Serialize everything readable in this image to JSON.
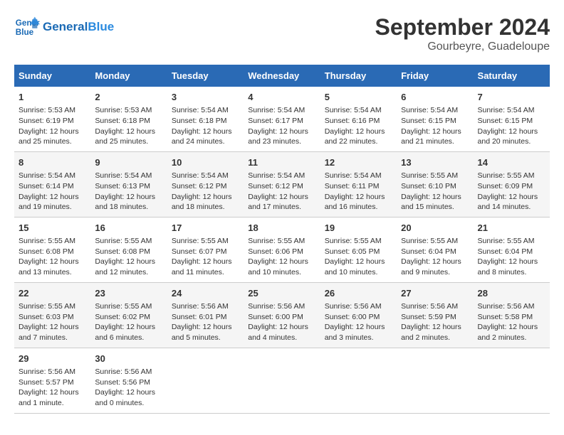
{
  "header": {
    "logo_line1": "General",
    "logo_line2": "Blue",
    "month": "September 2024",
    "location": "Gourbeyre, Guadeloupe"
  },
  "days_of_week": [
    "Sunday",
    "Monday",
    "Tuesday",
    "Wednesday",
    "Thursday",
    "Friday",
    "Saturday"
  ],
  "weeks": [
    [
      {
        "day": "1",
        "info": "Sunrise: 5:53 AM\nSunset: 6:19 PM\nDaylight: 12 hours and 25 minutes."
      },
      {
        "day": "2",
        "info": "Sunrise: 5:53 AM\nSunset: 6:18 PM\nDaylight: 12 hours and 25 minutes."
      },
      {
        "day": "3",
        "info": "Sunrise: 5:54 AM\nSunset: 6:18 PM\nDaylight: 12 hours and 24 minutes."
      },
      {
        "day": "4",
        "info": "Sunrise: 5:54 AM\nSunset: 6:17 PM\nDaylight: 12 hours and 23 minutes."
      },
      {
        "day": "5",
        "info": "Sunrise: 5:54 AM\nSunset: 6:16 PM\nDaylight: 12 hours and 22 minutes."
      },
      {
        "day": "6",
        "info": "Sunrise: 5:54 AM\nSunset: 6:15 PM\nDaylight: 12 hours and 21 minutes."
      },
      {
        "day": "7",
        "info": "Sunrise: 5:54 AM\nSunset: 6:15 PM\nDaylight: 12 hours and 20 minutes."
      }
    ],
    [
      {
        "day": "8",
        "info": "Sunrise: 5:54 AM\nSunset: 6:14 PM\nDaylight: 12 hours and 19 minutes."
      },
      {
        "day": "9",
        "info": "Sunrise: 5:54 AM\nSunset: 6:13 PM\nDaylight: 12 hours and 18 minutes."
      },
      {
        "day": "10",
        "info": "Sunrise: 5:54 AM\nSunset: 6:12 PM\nDaylight: 12 hours and 18 minutes."
      },
      {
        "day": "11",
        "info": "Sunrise: 5:54 AM\nSunset: 6:12 PM\nDaylight: 12 hours and 17 minutes."
      },
      {
        "day": "12",
        "info": "Sunrise: 5:54 AM\nSunset: 6:11 PM\nDaylight: 12 hours and 16 minutes."
      },
      {
        "day": "13",
        "info": "Sunrise: 5:55 AM\nSunset: 6:10 PM\nDaylight: 12 hours and 15 minutes."
      },
      {
        "day": "14",
        "info": "Sunrise: 5:55 AM\nSunset: 6:09 PM\nDaylight: 12 hours and 14 minutes."
      }
    ],
    [
      {
        "day": "15",
        "info": "Sunrise: 5:55 AM\nSunset: 6:08 PM\nDaylight: 12 hours and 13 minutes."
      },
      {
        "day": "16",
        "info": "Sunrise: 5:55 AM\nSunset: 6:08 PM\nDaylight: 12 hours and 12 minutes."
      },
      {
        "day": "17",
        "info": "Sunrise: 5:55 AM\nSunset: 6:07 PM\nDaylight: 12 hours and 11 minutes."
      },
      {
        "day": "18",
        "info": "Sunrise: 5:55 AM\nSunset: 6:06 PM\nDaylight: 12 hours and 10 minutes."
      },
      {
        "day": "19",
        "info": "Sunrise: 5:55 AM\nSunset: 6:05 PM\nDaylight: 12 hours and 10 minutes."
      },
      {
        "day": "20",
        "info": "Sunrise: 5:55 AM\nSunset: 6:04 PM\nDaylight: 12 hours and 9 minutes."
      },
      {
        "day": "21",
        "info": "Sunrise: 5:55 AM\nSunset: 6:04 PM\nDaylight: 12 hours and 8 minutes."
      }
    ],
    [
      {
        "day": "22",
        "info": "Sunrise: 5:55 AM\nSunset: 6:03 PM\nDaylight: 12 hours and 7 minutes."
      },
      {
        "day": "23",
        "info": "Sunrise: 5:55 AM\nSunset: 6:02 PM\nDaylight: 12 hours and 6 minutes."
      },
      {
        "day": "24",
        "info": "Sunrise: 5:56 AM\nSunset: 6:01 PM\nDaylight: 12 hours and 5 minutes."
      },
      {
        "day": "25",
        "info": "Sunrise: 5:56 AM\nSunset: 6:00 PM\nDaylight: 12 hours and 4 minutes."
      },
      {
        "day": "26",
        "info": "Sunrise: 5:56 AM\nSunset: 6:00 PM\nDaylight: 12 hours and 3 minutes."
      },
      {
        "day": "27",
        "info": "Sunrise: 5:56 AM\nSunset: 5:59 PM\nDaylight: 12 hours and 2 minutes."
      },
      {
        "day": "28",
        "info": "Sunrise: 5:56 AM\nSunset: 5:58 PM\nDaylight: 12 hours and 2 minutes."
      }
    ],
    [
      {
        "day": "29",
        "info": "Sunrise: 5:56 AM\nSunset: 5:57 PM\nDaylight: 12 hours and 1 minute."
      },
      {
        "day": "30",
        "info": "Sunrise: 5:56 AM\nSunset: 5:56 PM\nDaylight: 12 hours and 0 minutes."
      },
      {
        "day": "",
        "info": ""
      },
      {
        "day": "",
        "info": ""
      },
      {
        "day": "",
        "info": ""
      },
      {
        "day": "",
        "info": ""
      },
      {
        "day": "",
        "info": ""
      }
    ]
  ]
}
